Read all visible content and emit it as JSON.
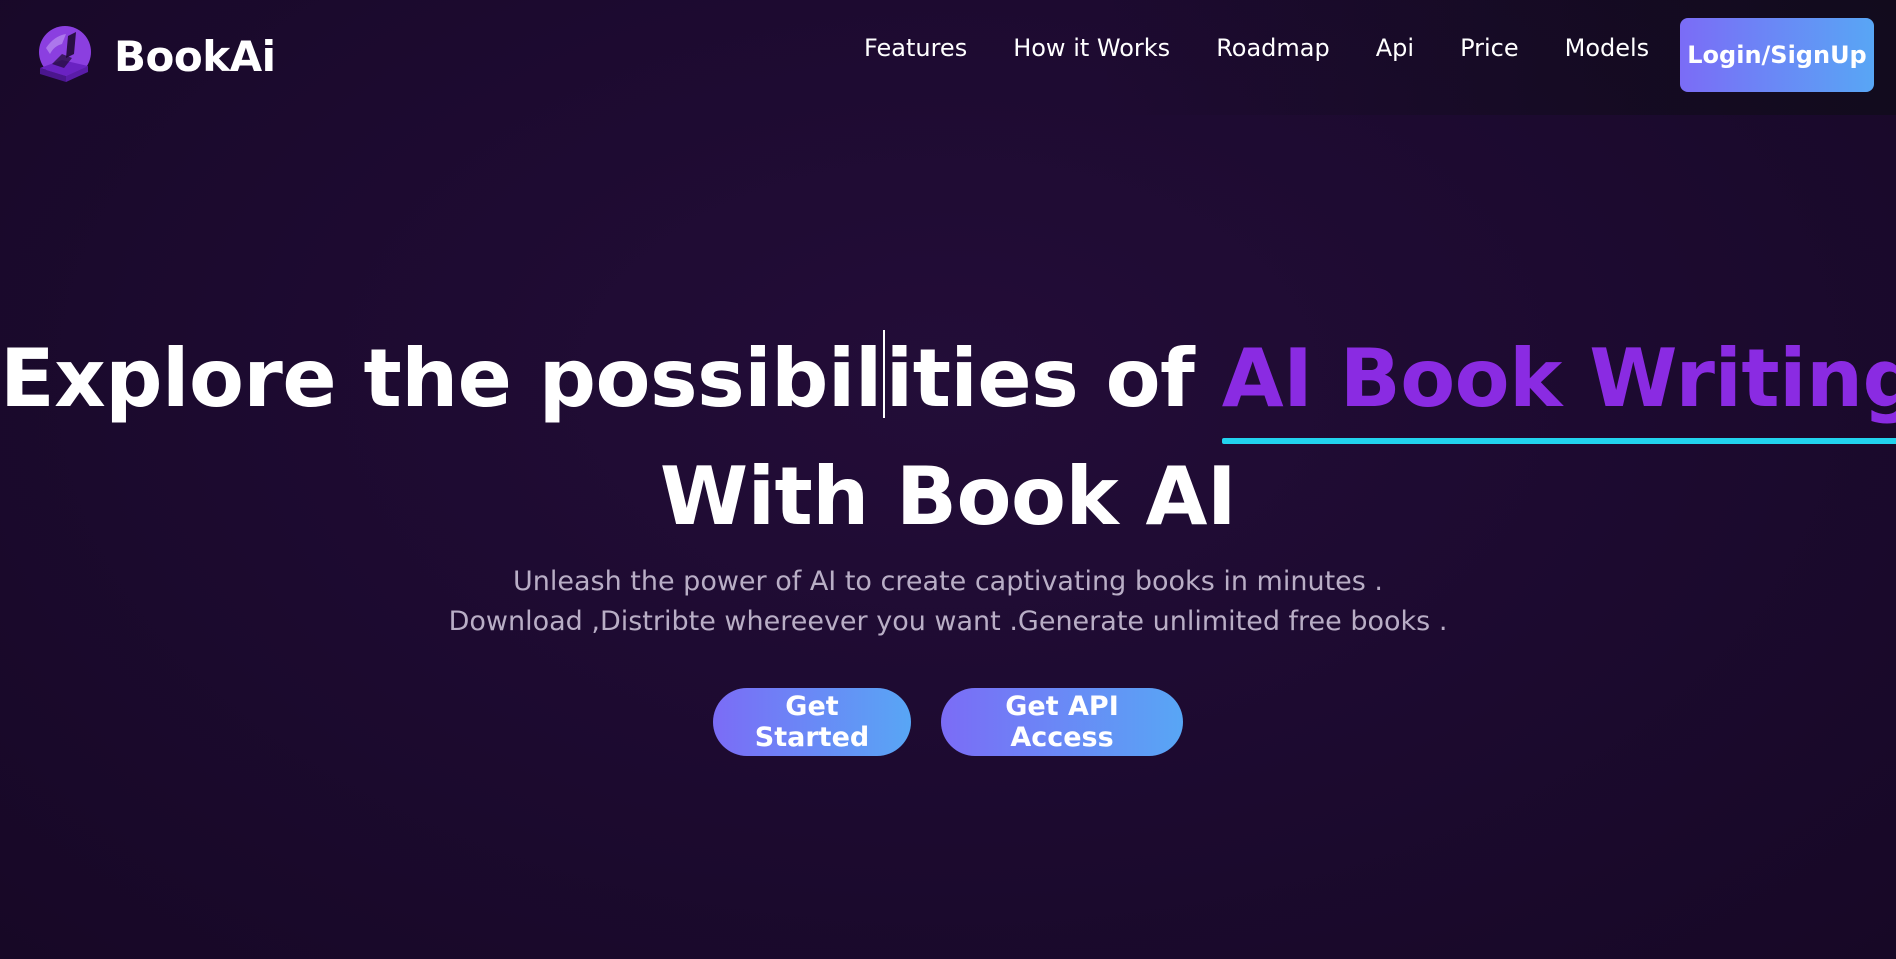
{
  "brand": {
    "name": "BookAi",
    "logo_icon": "book-globe-logo-icon",
    "logo_color": "#8b3fe0"
  },
  "nav": {
    "items": [
      {
        "label": "Features"
      },
      {
        "label": "How it Works"
      },
      {
        "label": "Roadmap"
      },
      {
        "label": "Api"
      },
      {
        "label": "Price"
      },
      {
        "label": "Models"
      }
    ],
    "login_label": "Login/SignUp"
  },
  "hero": {
    "headline_part1": "Explore the possibil",
    "headline_part2": "ities of ",
    "headline_highlight": "AI Book Writing",
    "headline_line2": "With Book AI",
    "subtitle_line1": "Unleash the power of AI to create captivating books in minutes .",
    "subtitle_line2": "Download ,Distribte whereever you want .Generate unlimited free books .",
    "cta_primary": "Get Started",
    "cta_secondary": "Get API Access"
  },
  "colors": {
    "background": "#1c0a2f",
    "accent_purple": "#8a2be2",
    "underline_cyan": "#22d3ee",
    "button_gradient_start": "#7b6cf6",
    "button_gradient_end": "#58a6f5",
    "subtitle_text": "#b9aec6"
  }
}
